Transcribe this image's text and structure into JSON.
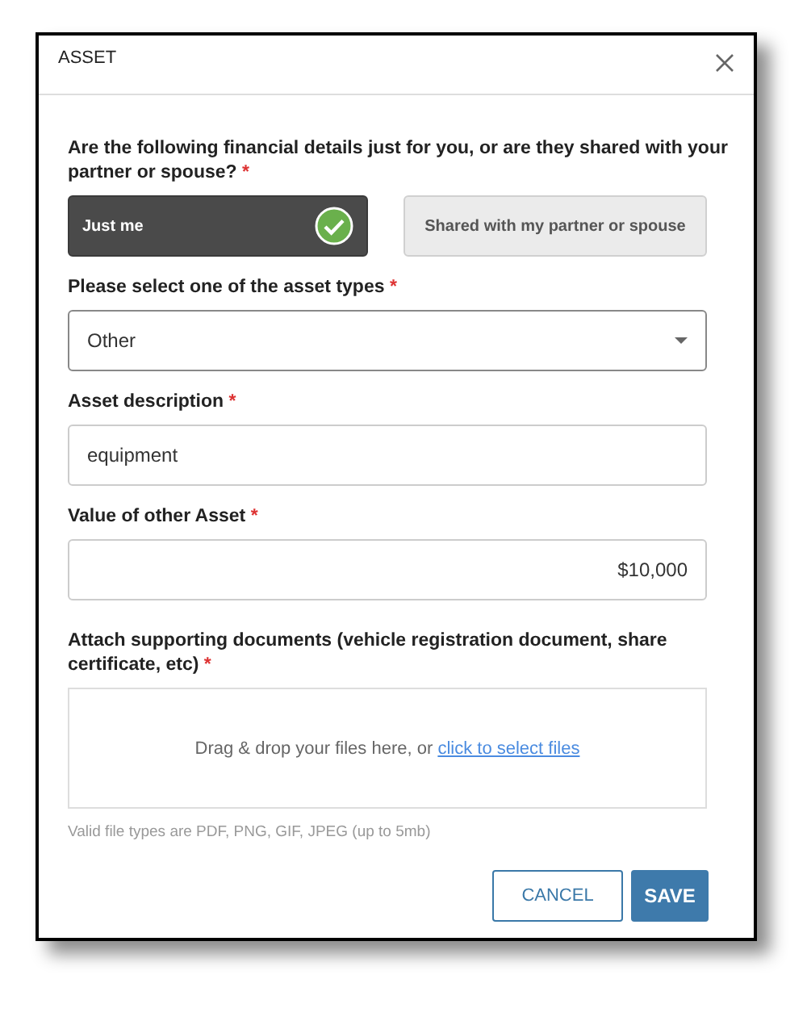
{
  "dialog": {
    "title": "ASSET"
  },
  "questions": [
    {
      "kind": "choice",
      "label": "Are the following financial details just for you, or are they shared with your partner or spouse?",
      "required_mark": "*",
      "options": [
        {
          "label": "Just me",
          "selected": true
        },
        {
          "label": "Shared with my partner or spouse",
          "selected": false
        }
      ]
    },
    {
      "kind": "select",
      "label": "Please select one of the asset types",
      "required_mark": "*",
      "value": "Other"
    },
    {
      "kind": "text",
      "label": "Asset description",
      "required_mark": "*",
      "value": "equipment"
    },
    {
      "kind": "amount",
      "label": "Value of other Asset",
      "required_mark": "*",
      "value": "$10,000"
    },
    {
      "kind": "upload",
      "label": "Attach supporting documents (vehicle registration document, share certificate, etc)",
      "required_mark": "*",
      "prompt": "Drag & drop your files here, or",
      "link": "click to select files",
      "hint": "Valid file types are PDF, PNG, GIF, JPEG (up to 5mb)"
    }
  ],
  "buttons": [
    {
      "label": "CANCEL",
      "kind": "secondary"
    },
    {
      "label": "SAVE",
      "kind": "primary"
    }
  ]
}
